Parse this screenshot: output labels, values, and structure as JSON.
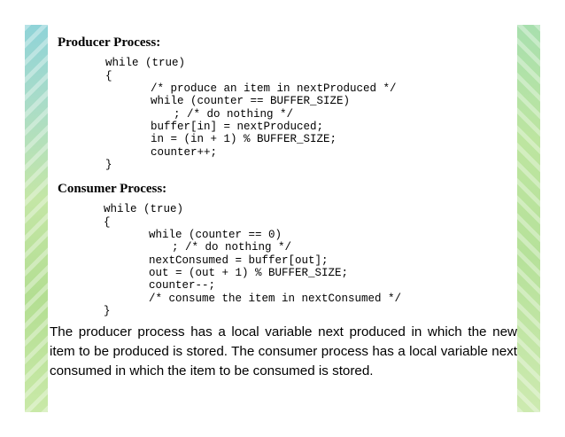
{
  "producer": {
    "heading": "Producer Process:",
    "code": [
      "while (true)",
      "{",
      "/* produce an item in nextProduced */",
      "while (counter == BUFFER_SIZE)",
      "; /* do nothing */",
      "buffer[in] = nextProduced;",
      "in = (in + 1) % BUFFER_SIZE;",
      "counter++;",
      "}"
    ]
  },
  "consumer": {
    "heading": "Consumer Process:",
    "code": [
      "while (true)",
      "{",
      "while (counter == 0)",
      "; /* do nothing */",
      "nextConsumed = buffer[out];",
      "out = (out + 1) % BUFFER_SIZE;",
      "counter--;",
      "/* consume the item in nextConsumed */",
      "}"
    ]
  },
  "description": "The producer process has a local variable next produced in which the new item to be produced is stored. The consumer process has a local variable next consumed in which the item to be consumed is stored.",
  "colors": {
    "border_top": "#8fd3d8",
    "border_bottom": "#c9e9a8"
  }
}
